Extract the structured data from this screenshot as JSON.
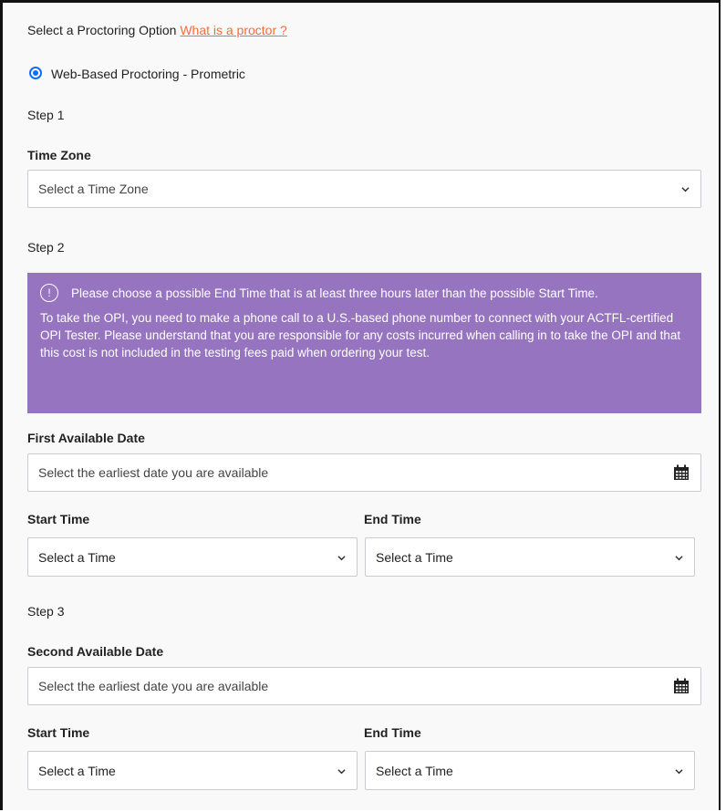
{
  "header": {
    "prompt": "Select a Proctoring Option",
    "link": "What is a proctor ?"
  },
  "proctoring": {
    "option_label": "Web-Based Proctoring - Prometric",
    "selected": true
  },
  "step1": {
    "label": "Step 1",
    "time_zone_label": "Time Zone",
    "time_zone_value": "Select a Time Zone"
  },
  "step2": {
    "label": "Step 2",
    "alert": {
      "icon": "exclamation-circle-icon",
      "icon_glyph": "!",
      "line1": "Please choose a possible End Time that is at least three hours later than the possible Start Time.",
      "line2": "To take the OPI, you need to make a phone call to a U.S.-based phone number to connect with your ACTFL-certified OPI Tester. Please understand that you are responsible for any costs incurred when calling in to take the OPI and that this cost is not included in the testing fees paid when ordering your test."
    },
    "date_label": "First Available Date",
    "date_placeholder": "Select the earliest date you are available",
    "start_label": "Start Time",
    "start_value": "Select a Time",
    "end_label": "End Time",
    "end_value": "Select a Time"
  },
  "step3": {
    "label": "Step 3",
    "date_label": "Second Available Date",
    "date_placeholder": "Select the earliest date you are available",
    "start_label": "Start Time",
    "start_value": "Select a Time",
    "end_label": "End Time",
    "end_value": "Select a Time"
  },
  "colors": {
    "alert_bg": "#9674c0",
    "link": "#ff6a33",
    "radio": "#0d6efd"
  }
}
